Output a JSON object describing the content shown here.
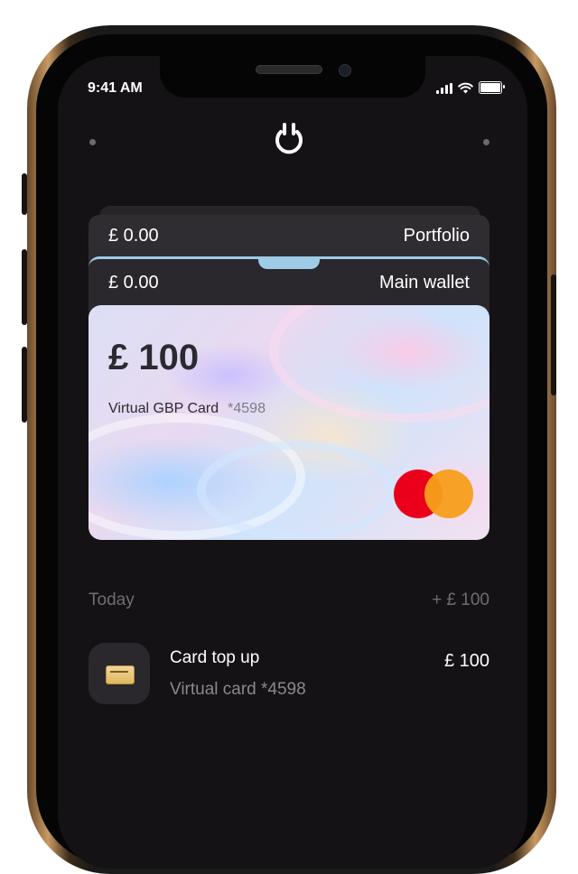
{
  "status_bar": {
    "time": "9:41 AM"
  },
  "cards": {
    "portfolio": {
      "amount": "£ 0.00",
      "name": "Portfolio"
    },
    "main_wallet": {
      "amount": "£ 0.00",
      "name": "Main wallet"
    },
    "virtual_card": {
      "balance": "£ 100",
      "label": "Virtual GBP Card",
      "number": "*4598",
      "network_icon": "mastercard-logo"
    }
  },
  "transactions": {
    "section_label": "Today",
    "section_total": "+ £ 100",
    "items": [
      {
        "title": "Card top up",
        "subtitle": "Virtual card *4598",
        "amount": "£ 100",
        "icon": "card-icon"
      }
    ]
  },
  "colors": {
    "screen_bg": "#141214",
    "card_dark": "#2f2d31",
    "accent_blue": "#9ecbe6",
    "mastercard_red": "#eb001b",
    "mastercard_orange": "#f79e1b"
  }
}
